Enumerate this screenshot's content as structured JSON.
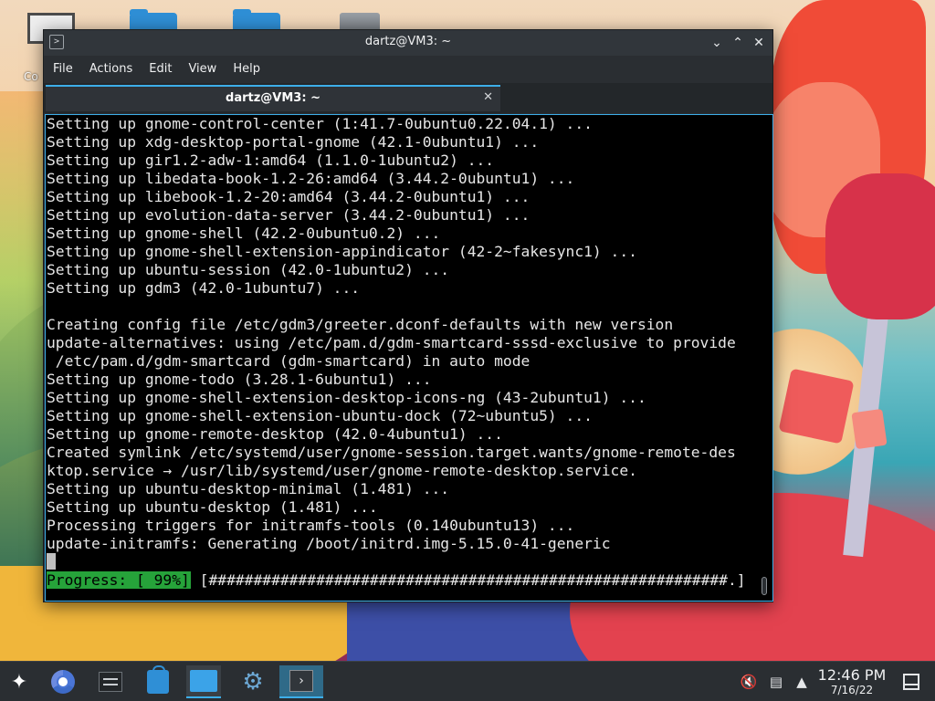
{
  "desktop": {
    "partial_icon_label": "Co"
  },
  "window": {
    "title": "dartz@VM3: ~",
    "menu": [
      "File",
      "Actions",
      "Edit",
      "View",
      "Help"
    ],
    "tab_title": "dartz@VM3: ~"
  },
  "terminal": {
    "lines": [
      "Setting up gnome-control-center (1:41.7-0ubuntu0.22.04.1) ...",
      "Setting up xdg-desktop-portal-gnome (42.1-0ubuntu1) ...",
      "Setting up gir1.2-adw-1:amd64 (1.1.0-1ubuntu2) ...",
      "Setting up libedata-book-1.2-26:amd64 (3.44.2-0ubuntu1) ...",
      "Setting up libebook-1.2-20:amd64 (3.44.2-0ubuntu1) ...",
      "Setting up evolution-data-server (3.44.2-0ubuntu1) ...",
      "Setting up gnome-shell (42.2-0ubuntu0.2) ...",
      "Setting up gnome-shell-extension-appindicator (42-2~fakesync1) ...",
      "Setting up ubuntu-session (42.0-1ubuntu2) ...",
      "Setting up gdm3 (42.0-1ubuntu7) ...",
      "",
      "Creating config file /etc/gdm3/greeter.dconf-defaults with new version",
      "update-alternatives: using /etc/pam.d/gdm-smartcard-sssd-exclusive to provide",
      " /etc/pam.d/gdm-smartcard (gdm-smartcard) in auto mode",
      "Setting up gnome-todo (3.28.1-6ubuntu1) ...",
      "Setting up gnome-shell-extension-desktop-icons-ng (43-2ubuntu1) ...",
      "Setting up gnome-shell-extension-ubuntu-dock (72~ubuntu5) ...",
      "Setting up gnome-remote-desktop (42.0-4ubuntu1) ...",
      "Created symlink /etc/systemd/user/gnome-session.target.wants/gnome-remote-des",
      "ktop.service → /usr/lib/systemd/user/gnome-remote-desktop.service.",
      "Setting up ubuntu-desktop-minimal (1.481) ...",
      "Setting up ubuntu-desktop (1.481) ...",
      "Processing triggers for initramfs-tools (0.140ubuntu13) ...",
      "update-initramfs: Generating /boot/initrd.img-5.15.0-41-generic"
    ],
    "progress_label": "Progress: [ 99%]",
    "progress_bar": "[##########################################################.]",
    "progress_percent": 99
  },
  "taskbar": {
    "clock_time": "12:46 PM",
    "clock_date": "7/16/22"
  },
  "colors": {
    "accent": "#3daee9",
    "progress_green": "#26a33a",
    "terminal_bg": "#000000"
  },
  "icons": [
    "kde-launcher-icon",
    "chrome-icon",
    "system-settings-icon",
    "discover-store-icon",
    "dolphin-files-icon",
    "settings-gear-icon",
    "konsole-icon",
    "volume-muted-icon",
    "network-wired-icon",
    "tray-expand-icon",
    "show-desktop-icon"
  ]
}
